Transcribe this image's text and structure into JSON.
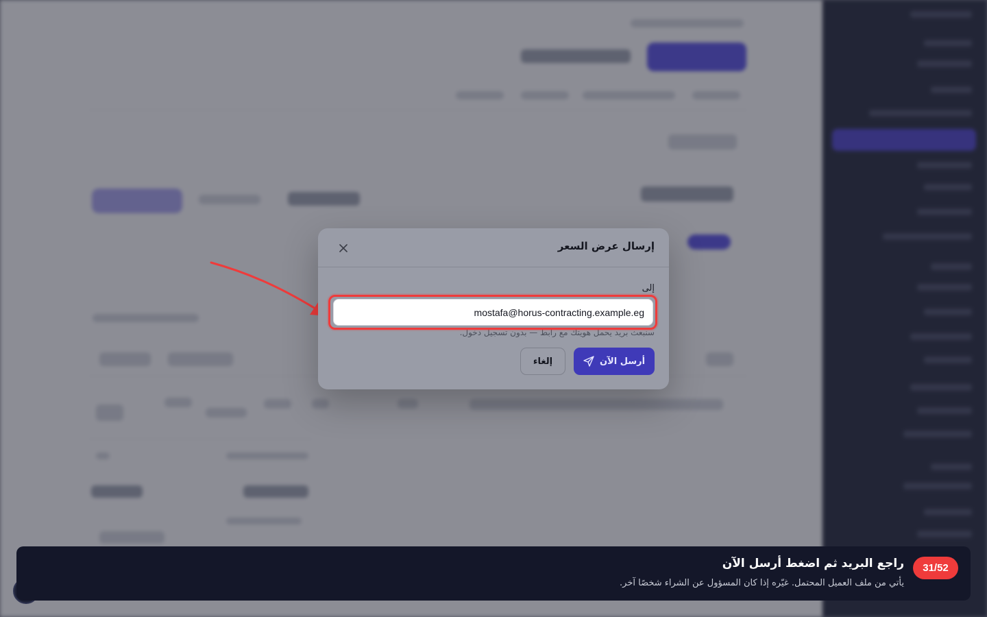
{
  "modal": {
    "title": "إرسال عرض السعر",
    "field_label": "إلى",
    "email_value": "mostafa@horus-contracting.example.eg",
    "helper_text": "سنبعث بريد يحمل هويتك مع رابط — بدون تسجيل دخول.",
    "send_label": "أرسل الآن",
    "cancel_label": "إلغاء"
  },
  "tour": {
    "step_counter": "31/52",
    "title": "راجع البريد ثم اضغط أرسل الآن",
    "description": "يأتي من ملف العميل المحتمل. غيّره إذا كان المسؤول عن الشراء شخصًا آخر."
  },
  "icons": {
    "close": "close-icon",
    "send": "send-icon",
    "pointer": "arrow-pointer"
  },
  "colors": {
    "accent": "#4f46e5",
    "send_button": "#3f3ab8",
    "highlight": "#ef3b3b",
    "tour_background": "#141729"
  }
}
